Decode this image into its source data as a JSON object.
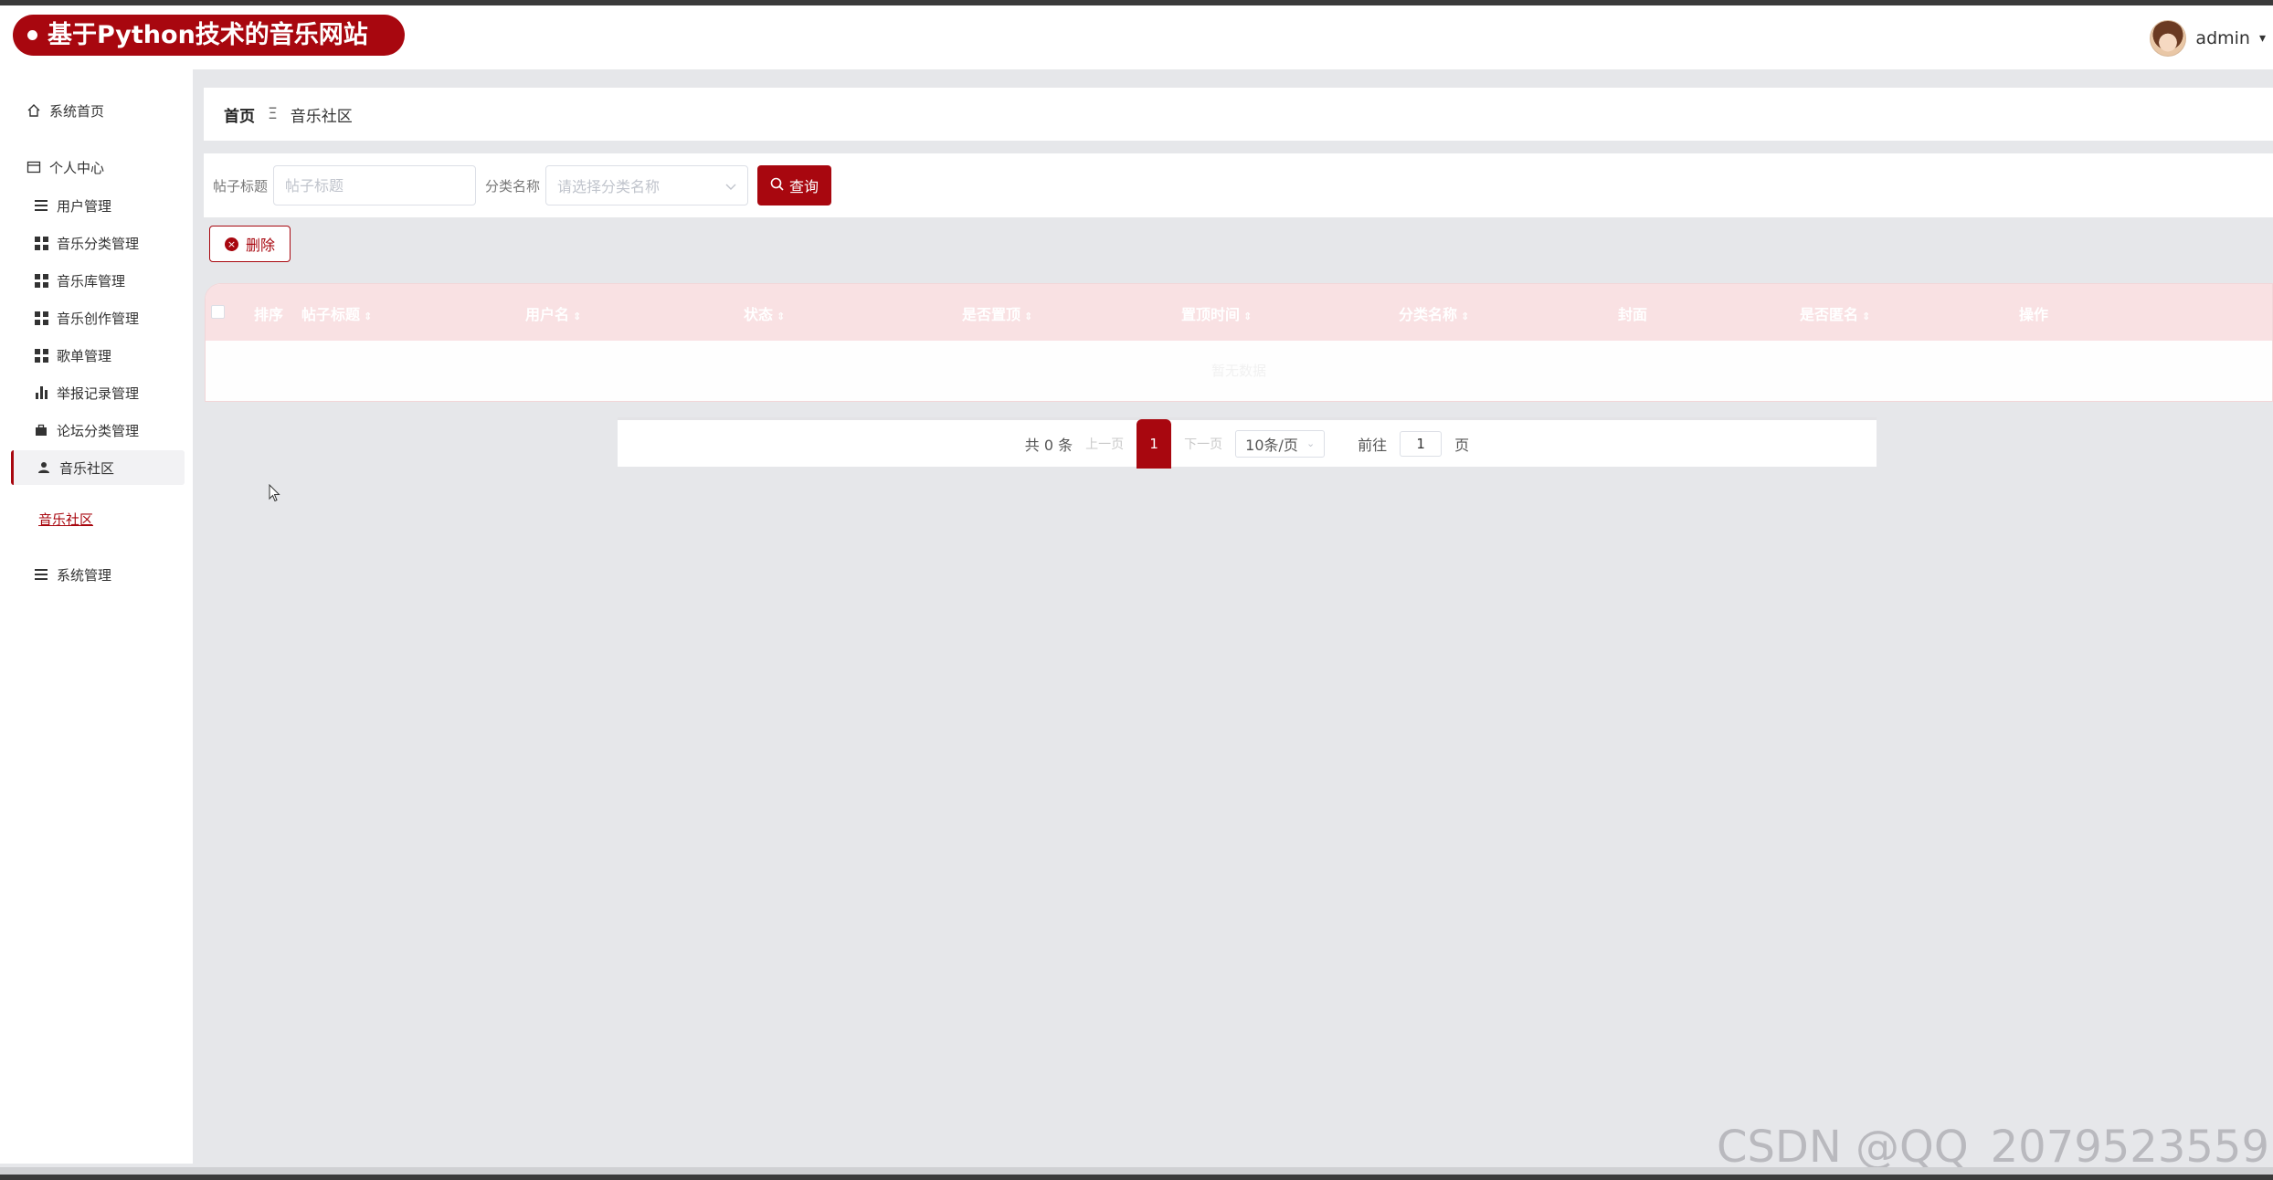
{
  "header": {
    "brand_title": "基于Python技术的音乐网站",
    "username": "admin",
    "caret": "▾"
  },
  "sidebar": {
    "home": "系统首页",
    "personal_center": "个人中心",
    "items": [
      {
        "label": "用户管理",
        "icon": "list-icon"
      },
      {
        "label": "音乐分类管理",
        "icon": "grid-icon"
      },
      {
        "label": "音乐库管理",
        "icon": "grid-icon"
      },
      {
        "label": "音乐创作管理",
        "icon": "grid-icon"
      },
      {
        "label": "歌单管理",
        "icon": "grid-icon"
      },
      {
        "label": "举报记录管理",
        "icon": "bar-chart-icon"
      },
      {
        "label": "论坛分类管理",
        "icon": "briefcase-icon"
      },
      {
        "label": "音乐社区",
        "icon": "user-icon"
      }
    ],
    "sub_link": "音乐社区",
    "system": "系统管理"
  },
  "breadcrumb": {
    "home": "首页",
    "separator": "Ξ",
    "current": "音乐社区"
  },
  "search": {
    "title_label": "帖子标题",
    "title_placeholder": "帖子标题",
    "category_label": "分类名称",
    "category_placeholder": "请选择分类名称",
    "query_button": "查询"
  },
  "actions": {
    "delete_button": "删除"
  },
  "table": {
    "columns": [
      "排序",
      "帖子标题",
      "用户名",
      "状态",
      "是否置顶",
      "置顶时间",
      "分类名称",
      "封面",
      "是否匿名",
      "操作"
    ],
    "empty_text": "暂无数据"
  },
  "pagination": {
    "total": "共 0 条",
    "prev": "上一页",
    "current_page": "1",
    "next": "下一页",
    "page_size": "10条/页",
    "goto_label": "前往",
    "goto_value": "1",
    "page_suffix": "页"
  },
  "watermark": "CSDN @QQ_2079523559",
  "colors": {
    "accent": "#a8070f",
    "header_row": "#f9e1e3",
    "background": "#e6e7ea"
  }
}
